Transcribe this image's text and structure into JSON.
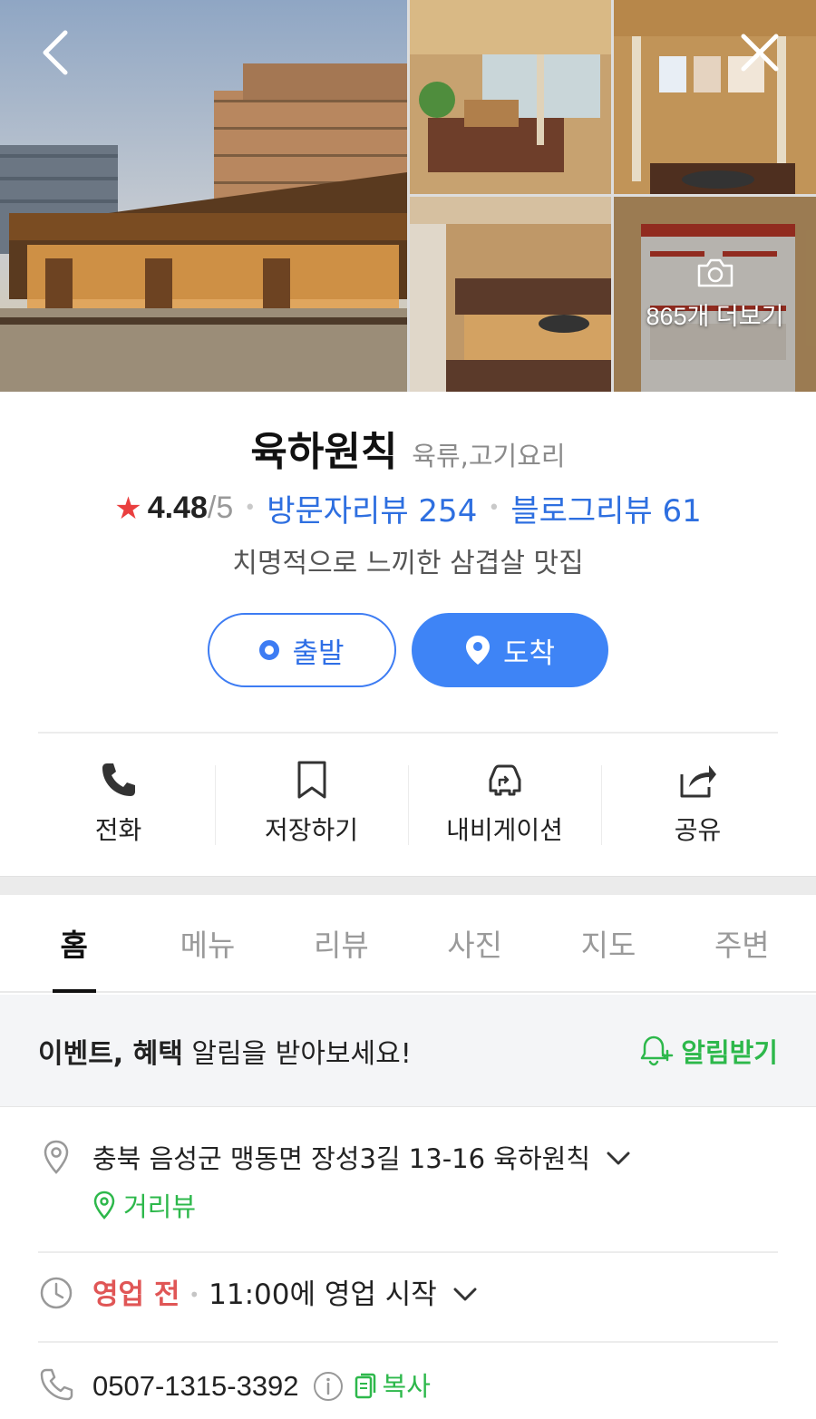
{
  "gallery": {
    "more_label": "865개 더보기"
  },
  "place": {
    "name": "육하원칙",
    "category": "육류,고기요리",
    "rating": "4.48",
    "rating_max": "/5",
    "visitor_reviews": "방문자리뷰 254",
    "blog_reviews": "블로그리뷰 61",
    "tagline": "치명적으로 느끼한 삼겹살 맛집"
  },
  "route": {
    "depart_label": "출발",
    "arrive_label": "도착"
  },
  "actions": [
    {
      "label": "전화",
      "icon": "phone-icon"
    },
    {
      "label": "저장하기",
      "icon": "bookmark-icon"
    },
    {
      "label": "내비게이션",
      "icon": "car-navigation-icon"
    },
    {
      "label": "공유",
      "icon": "share-icon"
    }
  ],
  "tabs": [
    "홈",
    "메뉴",
    "리뷰",
    "사진",
    "지도",
    "주변"
  ],
  "notice": {
    "strong": "이벤트, 혜택",
    "rest": " 알림을 받아보세요!",
    "button": "알림받기"
  },
  "info": {
    "address": "충북 음성군 맹동면 장성3길 13-16 육하원칙",
    "street_view": "거리뷰",
    "hours_status": "영업 전",
    "hours_detail": "11:00에 영업 시작",
    "phone": "0507-1315-3392",
    "copy_label": "복사"
  },
  "colors": {
    "accent_blue": "#3e84f6",
    "green": "#2db84b",
    "star_red": "#ea3f3f",
    "status_red": "#e05656"
  }
}
